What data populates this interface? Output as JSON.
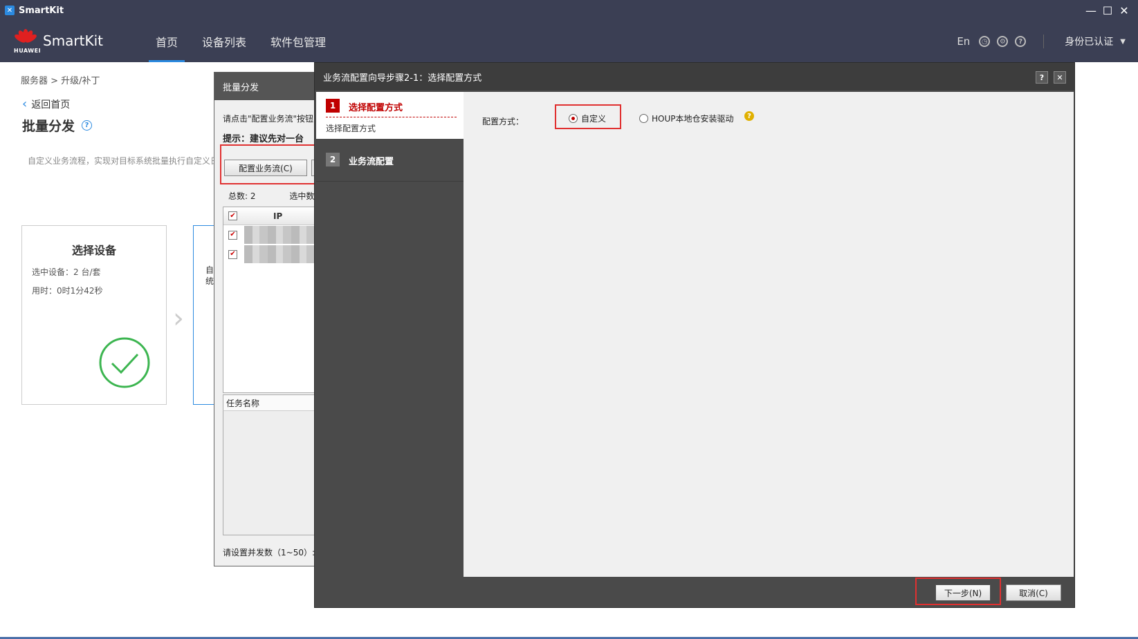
{
  "window": {
    "title": "SmartKit",
    "controls": [
      "minimize",
      "maximize",
      "close"
    ]
  },
  "nav": {
    "logo_text": "HUAWEI",
    "brand": "SmartKit",
    "tabs": [
      {
        "label": "首页",
        "active": true
      },
      {
        "label": "设备列表",
        "active": false
      },
      {
        "label": "软件包管理",
        "active": false
      }
    ],
    "lang": "En",
    "auth": "身份已认证",
    "icons": [
      "clock-icon",
      "gear-icon",
      "help-icon"
    ]
  },
  "page": {
    "breadcrumb": "服务器 > 升级/补丁",
    "back": "返回首页",
    "title": "批量分发",
    "desc": "自定义业务流程，实现对目标系统批量执行自定义日"
  },
  "steps": {
    "card1": {
      "title": "选择设备",
      "selected": "选中设备：2 台/套",
      "time": "用时：0时1分42秒"
    },
    "card2": {
      "line1": "自",
      "line2": "统"
    }
  },
  "batch": {
    "title": "批量分发",
    "hint1": "请点击\"配置业务流\"按钮自",
    "hint2": "提示：建议先对一台",
    "config_btn": "配置业务流(C)",
    "total": "总数: 2",
    "selected": "选中数:",
    "table": {
      "ip_header": "IP",
      "rows": [
        {
          "checked": true
        },
        {
          "checked": true
        }
      ],
      "header_checked": true
    },
    "task_header": "任务名称",
    "concurrency": "请设置并发数（1~50）:"
  },
  "wizard": {
    "title": "业务流配置向导步骤2-1：选择配置方式",
    "help_btn": "?",
    "close_btn": "✕",
    "steps": [
      {
        "num": "1",
        "label": "选择配置方式",
        "sub": "选择配置方式",
        "active": true
      },
      {
        "num": "2",
        "label": "业务流配置",
        "active": false
      }
    ],
    "config_label": "配置方式：",
    "options": [
      {
        "label": "自定义",
        "selected": true
      },
      {
        "label": "HOUP本地仓安装驱动",
        "selected": false
      }
    ],
    "next_btn": "下一步(N)",
    "cancel_btn": "取消(C)"
  },
  "colors": {
    "nav_bg": "#3b3f54",
    "accent": "#2b8ae0",
    "wizard_bg": "#4a4a4a",
    "highlight": "#e03030",
    "step_red": "#c00000"
  }
}
